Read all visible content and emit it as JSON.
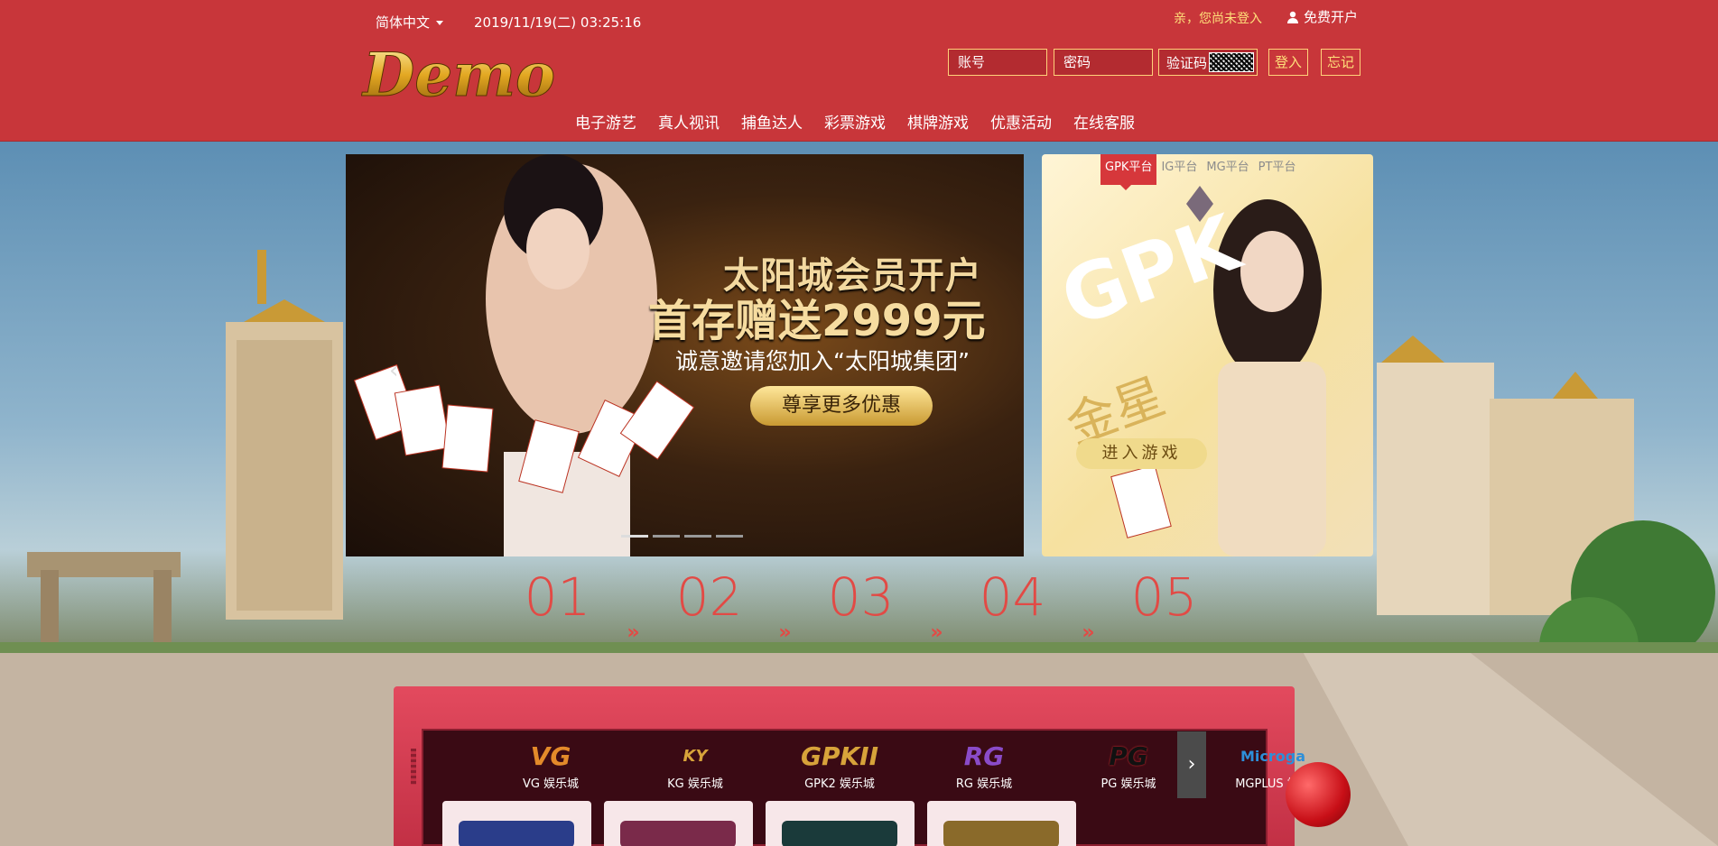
{
  "header": {
    "language": "简体中文",
    "datetime": "2019/11/19(二) 03:25:16",
    "login_status": "亲，您尚未登入",
    "register": "免费开户",
    "logo_text": "Demo",
    "account_placeholder": "账号",
    "password_placeholder": "密码",
    "captcha_label": "验证码",
    "login_button": "登入",
    "forgot_button": "忘记",
    "nav": [
      "电子游艺",
      "真人视讯",
      "捕鱼达人",
      "彩票游戏",
      "棋牌游戏",
      "优惠活动",
      "在线客服"
    ]
  },
  "banner": {
    "title": "太阳城会员开户",
    "subtitle": "首存赠送2999元",
    "invite": "诚意邀请您加入“太阳城集团”",
    "button": "尊享更多优惠",
    "slide_count": 4,
    "active_slide": 1
  },
  "side_panel": {
    "tabs": [
      "GPK平台",
      "IG平台",
      "MG平台",
      "PT平台"
    ],
    "active_tab": "GPK平台",
    "brand": "GPK",
    "subtitle": "金星",
    "enter_button": "进入游戏"
  },
  "steps": [
    {
      "num": "01",
      "label": ""
    },
    {
      "num": "02",
      "label": ""
    },
    {
      "num": "03",
      "label": ""
    },
    {
      "num": "04",
      "label": ""
    },
    {
      "num": "05",
      "label": ""
    }
  ],
  "games": [
    {
      "logo": "VG",
      "label": "VG 娱乐城"
    },
    {
      "logo": "KY",
      "label": "KG 娱乐城"
    },
    {
      "logo": "GPKII",
      "label": "GPK2 娱乐城"
    },
    {
      "logo": "RG",
      "label": "RG 娱乐城"
    },
    {
      "logo": "PG",
      "label": "PG 娱乐城"
    },
    {
      "logo": "Microga",
      "label": "MGPLUS 娱乐"
    }
  ],
  "colors": {
    "header_bg": "#c8363a",
    "accent_gold": "#ffd27a",
    "step_red": "#e24a45"
  }
}
